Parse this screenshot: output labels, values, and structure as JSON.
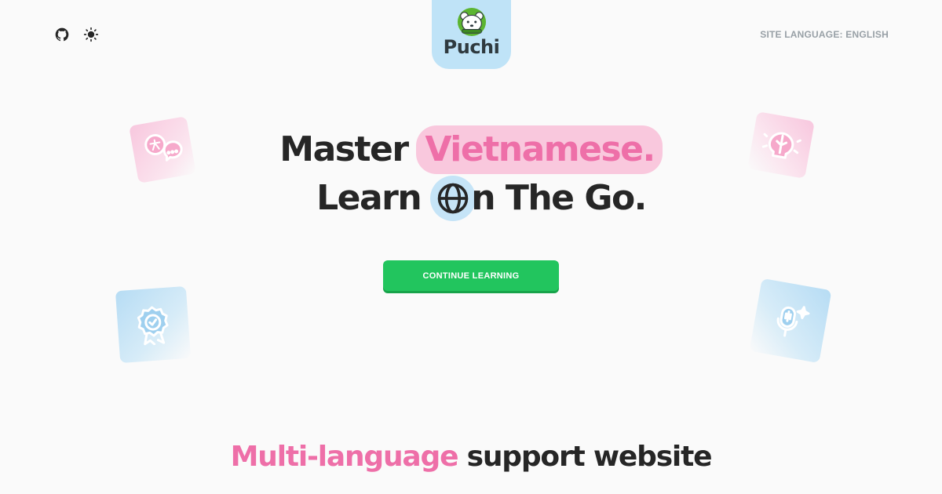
{
  "header": {
    "icons": [
      "github-icon",
      "sun-icon"
    ],
    "logo_text": "Puchi",
    "site_language_label": "SITE LANGUAGE: ENGLISH"
  },
  "hero": {
    "line1_prefix": "Master",
    "line1_highlight": "Vietnamese.",
    "line2_prefix": "Learn",
    "line2_suffix": "n The Go."
  },
  "cta_label": "CONTINUE LEARNING",
  "tagline": {
    "highlight": "Multi-language",
    "rest": "support website"
  },
  "decorations": [
    "translate-icon",
    "brain-idea-icon",
    "award-badge-icon",
    "voice-sparkle-icon"
  ],
  "colors": {
    "background": "#fafafa",
    "brand_blue": "#bfe3f7",
    "pink_accent": "#ee6fa8",
    "pink_highlight": "#f9c8dd",
    "cta_green": "#22c55e",
    "text_dark": "#262626"
  }
}
